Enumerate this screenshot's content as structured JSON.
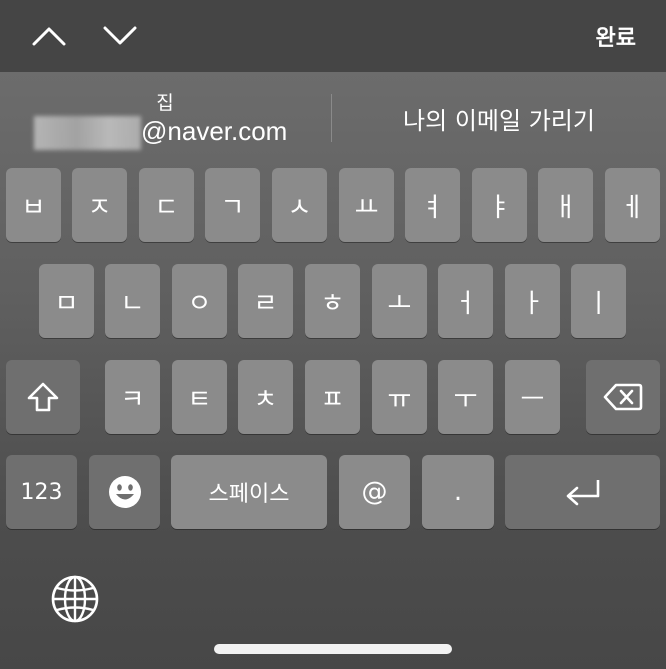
{
  "toolbar": {
    "up_icon": "chevron-up-icon",
    "down_icon": "chevron-down-icon",
    "done_label": "완료"
  },
  "suggestions": {
    "left_label": "집",
    "left_email_domain": "@naver.com",
    "right_label": "나의 이메일 가리기"
  },
  "keyboard": {
    "row1": [
      "ㅂ",
      "ㅈ",
      "ㄷ",
      "ㄱ",
      "ㅅ",
      "ㅛ",
      "ㅕ",
      "ㅑ",
      "ㅐ",
      "ㅔ"
    ],
    "row2": [
      "ㅁ",
      "ㄴ",
      "ㅇ",
      "ㄹ",
      "ㅎ",
      "ㅗ",
      "ㅓ",
      "ㅏ",
      "ㅣ"
    ],
    "row3": [
      "ㅋ",
      "ㅌ",
      "ㅊ",
      "ㅍ",
      "ㅠ",
      "ㅜ",
      "ㅡ"
    ],
    "numbers_label": "123",
    "space_label": "스페이스",
    "at_label": "@",
    "period_label": ".",
    "shift_icon": "shift-icon",
    "delete_icon": "delete-icon",
    "emoji_icon": "emoji-icon",
    "return_icon": "return-icon",
    "globe_icon": "globe-icon"
  },
  "colors": {
    "key": "#8b8b8b",
    "special_key": "#6f6f6f",
    "toolbar": "#454545"
  }
}
